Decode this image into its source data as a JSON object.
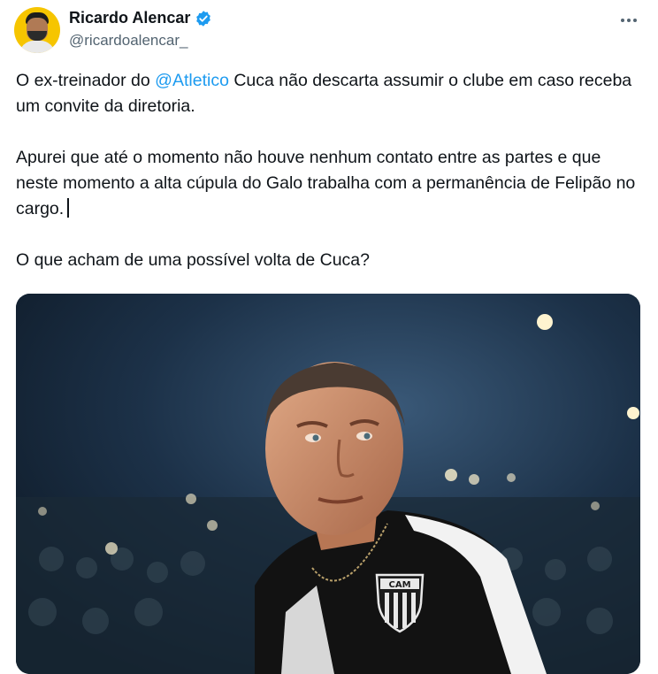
{
  "author": {
    "display_name": "Ricardo Alencar",
    "handle": "@ricardoalencar_",
    "verified": true,
    "avatar_icon": "avatar-photo"
  },
  "tweet": {
    "line1_before": "O ex-treinador do ",
    "mention": "@Atletico",
    "line1_after": " Cuca não descarta assumir o clube em caso receba um convite da diretoria.",
    "para2": "Apurei que até o momento não houve nenhum contato entre as partes e que neste momento a alta cúpula do Galo trabalha com a permanência de Felipão no cargo.",
    "para3": "O que acham de uma possível volta de Cuca?"
  },
  "media": {
    "crest_text": "CAM",
    "description_icon": "photo-icon"
  },
  "colors": {
    "link": "#1d9bf0",
    "verified": "#1d9bf0",
    "secondary": "#536471"
  }
}
